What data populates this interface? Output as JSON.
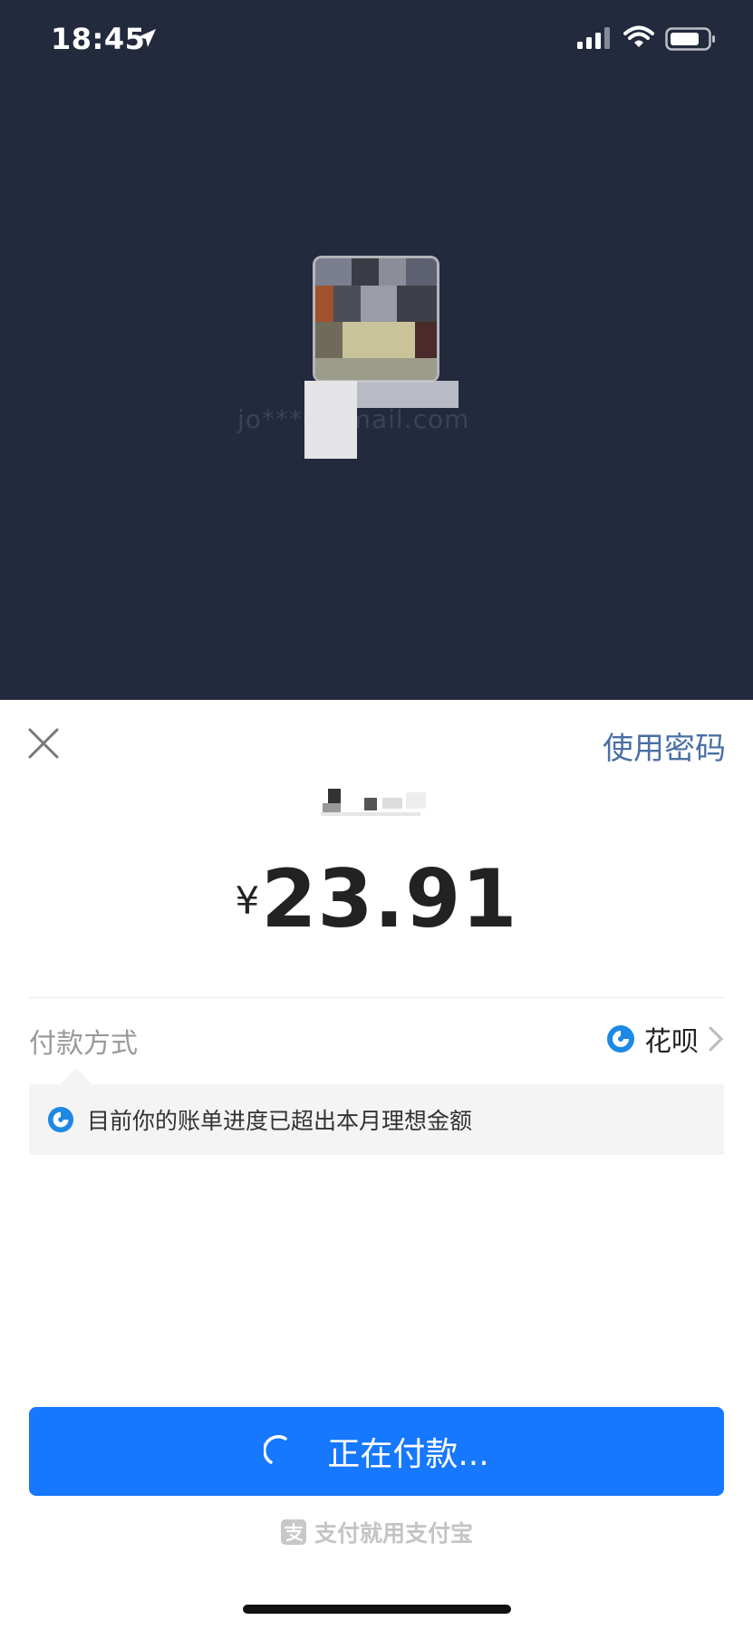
{
  "status_bar": {
    "time": "18:45"
  },
  "header": {
    "account": "jo***@gmail.com",
    "use_password_label": "使用密码"
  },
  "payment": {
    "currency_symbol": "¥",
    "amount": "23.91"
  },
  "pay_method": {
    "label": "付款方式",
    "value": "花呗"
  },
  "notice": {
    "text": "目前你的账单进度已超出本月理想金额"
  },
  "pay_button": {
    "label": "正在付款..."
  },
  "footer": {
    "text": "支付就用支付宝"
  },
  "colors": {
    "top_background": "#232a3e",
    "accent_blue": "#1677ff",
    "link_blue": "#4a6fa5",
    "huabei_blue": "#1e88e5"
  }
}
